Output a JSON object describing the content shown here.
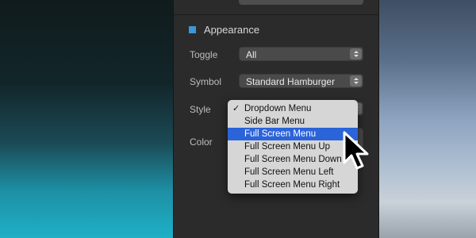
{
  "section": {
    "title": "Appearance",
    "icon": "square-icon",
    "accent": "#3b97d9"
  },
  "fields": {
    "toggle": {
      "label": "Toggle",
      "value": "All"
    },
    "symbol": {
      "label": "Symbol",
      "value": "Standard Hamburger"
    },
    "style": {
      "label": "Style"
    },
    "color": {
      "label": "Color"
    }
  },
  "menu": {
    "checkmark": "✓",
    "items": [
      {
        "label": "Dropdown Menu",
        "checked": true
      },
      {
        "label": "Side Bar Menu"
      },
      {
        "label": "Full Screen Menu",
        "highlighted": true
      },
      {
        "label": "Full Screen Menu Up"
      },
      {
        "label": "Full Screen Menu Down"
      },
      {
        "label": "Full Screen Menu Left"
      },
      {
        "label": "Full Screen Menu Right"
      }
    ],
    "highlight_color": "#2b63d9"
  },
  "cursor": {
    "icon": "arrow-cursor-icon"
  }
}
